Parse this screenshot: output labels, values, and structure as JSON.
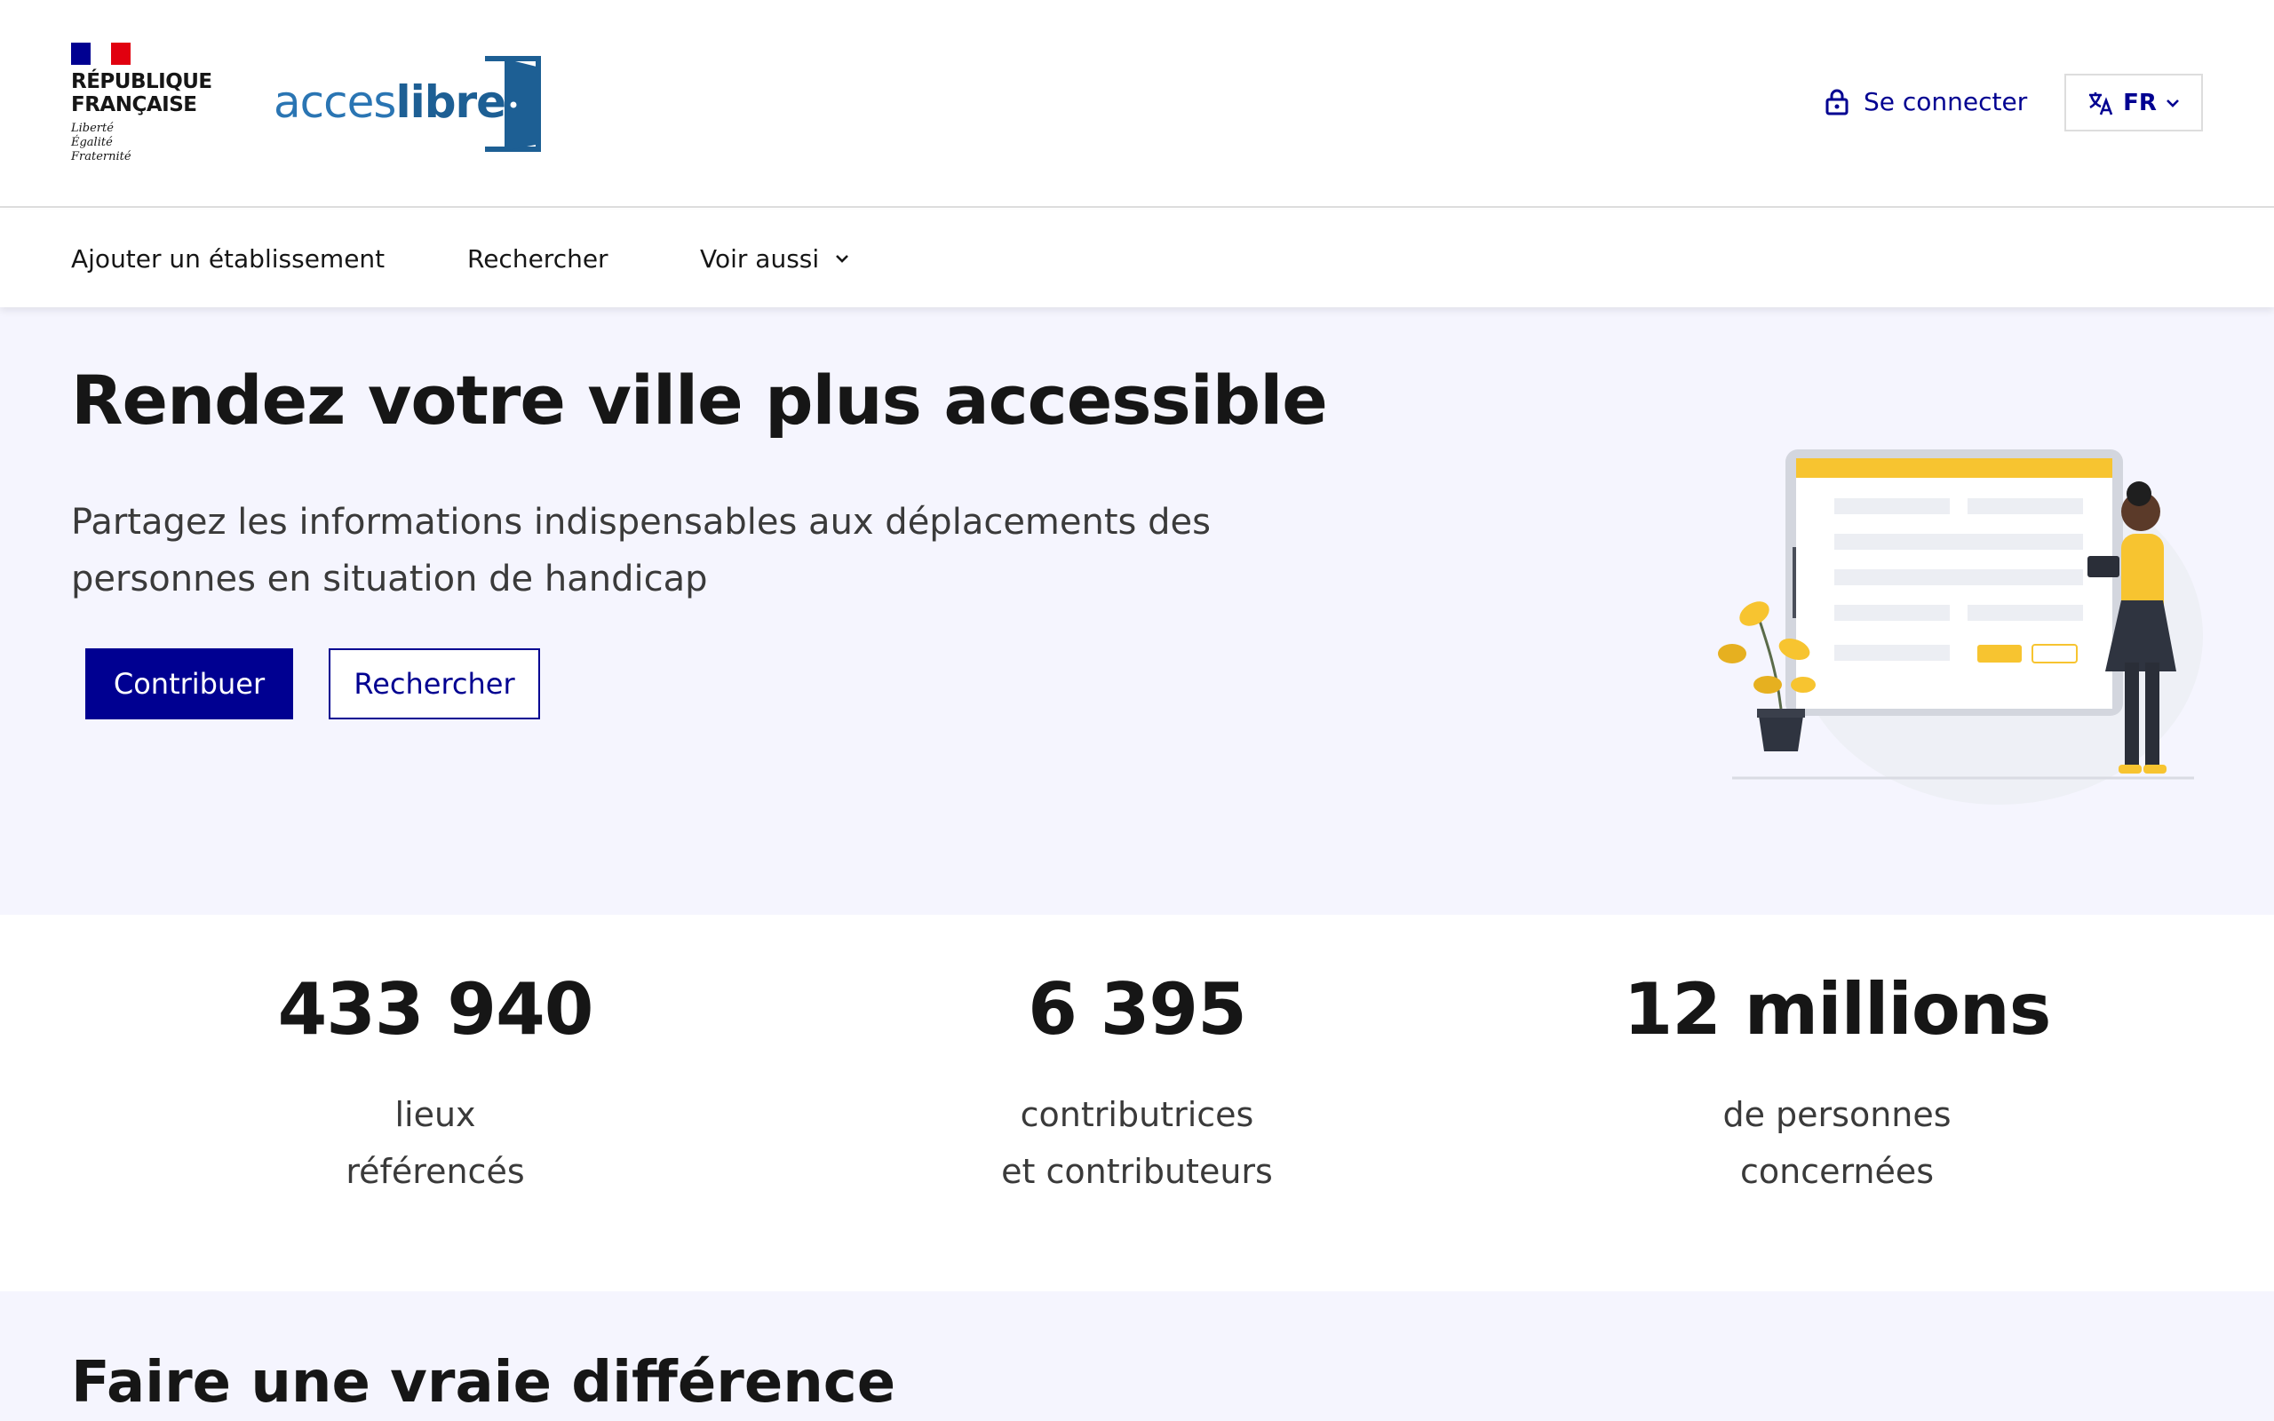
{
  "header": {
    "republique": {
      "line1": "RÉPUBLIQUE",
      "line2": "FRANÇAISE",
      "motto": [
        "Liberté",
        "Égalité",
        "Fraternité"
      ],
      "flag_colors": [
        "#000091",
        "#ffffff",
        "#e1000f"
      ]
    },
    "logo": {
      "part1": "acces",
      "part2": "libre"
    },
    "login_label": "Se connecter",
    "login_icon": "lock-icon",
    "lang_label": "FR",
    "lang_icon": "translate-icon"
  },
  "nav": {
    "items": [
      {
        "label": "Ajouter un établissement"
      },
      {
        "label": "Rechercher"
      },
      {
        "label": "Voir aussi"
      }
    ]
  },
  "hero": {
    "title": "Rendez votre ville plus accessible",
    "subtitle": "Partagez les informations indispensables aux déplacements des personnes en situation de handicap",
    "primary_button": "Contribuer",
    "secondary_button": "Rechercher"
  },
  "stats": [
    {
      "value": "433 940",
      "label_line1": "lieux",
      "label_line2": "référencés"
    },
    {
      "value": "6 395",
      "label_line1": "contributrices",
      "label_line2": "et contributeurs"
    },
    {
      "value": "12 millions",
      "label_line1": "de personnes",
      "label_line2": "concernées"
    }
  ],
  "section_title": "Faire une vraie différence",
  "colors": {
    "primary": "#000091",
    "hero_bg": "#f5f5fe",
    "accent_yellow": "#f7c430",
    "logo_blue": "#1d5f94"
  }
}
